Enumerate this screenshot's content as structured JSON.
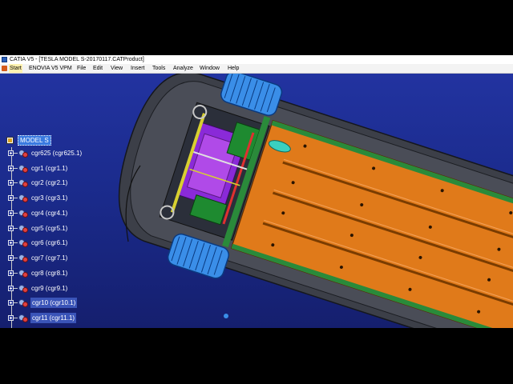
{
  "window": {
    "title": "CATIA V5 - [TESLA MODEL S-20170117.CATProduct]",
    "icon": "catia-app-icon"
  },
  "menubar": {
    "items": [
      "Start",
      "ENOVIA V5 VPM",
      "File",
      "Edit",
      "View",
      "Insert",
      "Tools",
      "Analyze",
      "Window",
      "Help"
    ]
  },
  "tree": {
    "root": "MODEL S",
    "nodes": [
      "cgr625 (cgr625.1)",
      "cgr1 (cgr1.1)",
      "cgr2 (cgr2.1)",
      "cgr3 (cgr3.1)",
      "cgr4 (cgr4.1)",
      "cgr5 (cgr5.1)",
      "cgr6 (cgr6.1)",
      "cgr7 (cgr7.1)",
      "cgr8 (cgr8.1)",
      "cgr9 (cgr9.1)",
      "cgr10 (cgr10.1)",
      "cgr11 (cgr11.1)"
    ]
  },
  "colors": {
    "viewport_bg": "#1c2a82",
    "battery_orange": "#e07a1a",
    "wheel_blue": "#3a8ee8",
    "chassis_gray": "#3c3f48"
  }
}
